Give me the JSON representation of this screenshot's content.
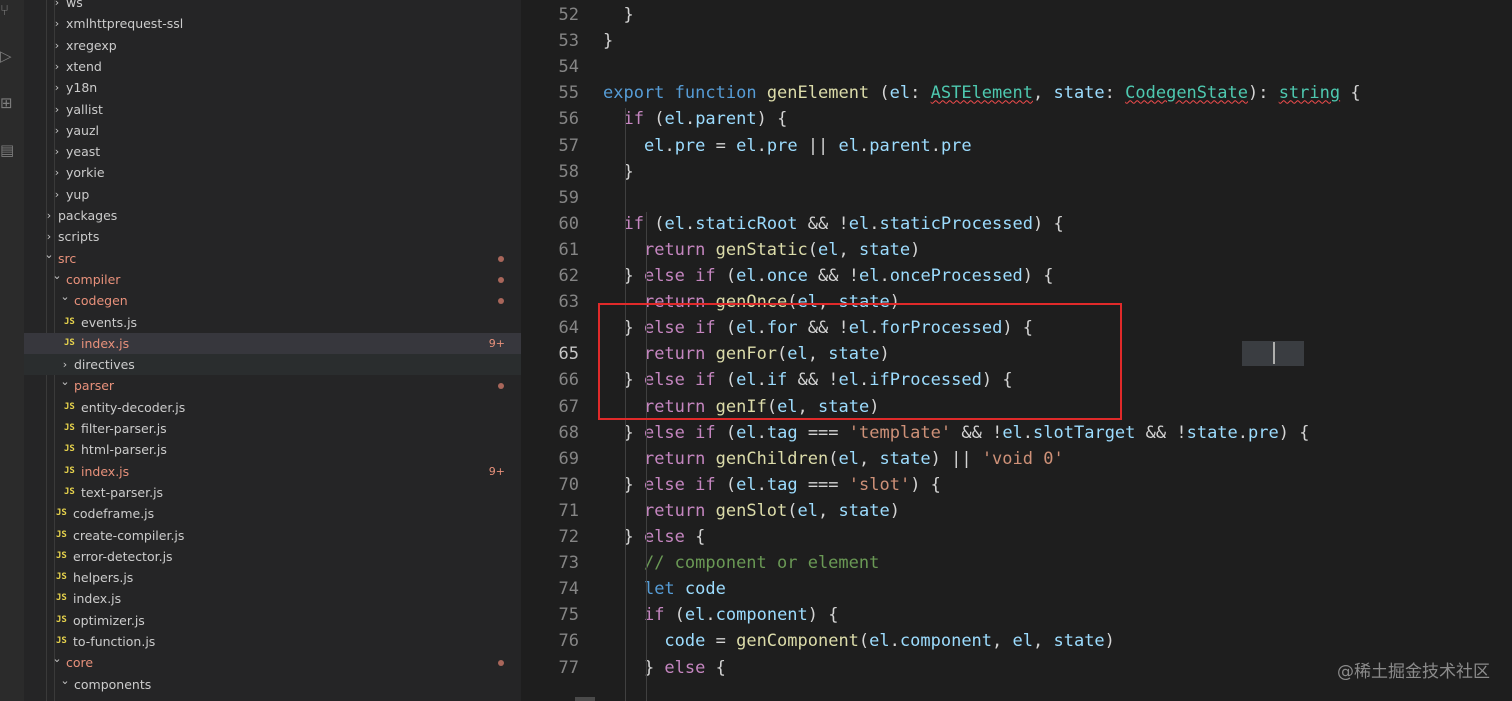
{
  "explorer": {
    "rows": [
      {
        "name": "ws",
        "kind": "folder",
        "depth": 1
      },
      {
        "name": "xmlhttprequest-ssl",
        "kind": "folder",
        "depth": 1
      },
      {
        "name": "xregexp",
        "kind": "folder",
        "depth": 1
      },
      {
        "name": "xtend",
        "kind": "folder",
        "depth": 1
      },
      {
        "name": "y18n",
        "kind": "folder",
        "depth": 1
      },
      {
        "name": "yallist",
        "kind": "folder",
        "depth": 1
      },
      {
        "name": "yauzl",
        "kind": "folder",
        "depth": 1
      },
      {
        "name": "yeast",
        "kind": "folder",
        "depth": 1
      },
      {
        "name": "yorkie",
        "kind": "folder",
        "depth": 1
      },
      {
        "name": "yup",
        "kind": "folder",
        "depth": 1
      },
      {
        "name": "packages",
        "kind": "folder",
        "depth": 0
      },
      {
        "name": "scripts",
        "kind": "folder",
        "depth": 0
      },
      {
        "name": "src",
        "kind": "folder",
        "depth": 0,
        "open": true,
        "modified": true,
        "dot": true
      },
      {
        "name": "compiler",
        "kind": "folder",
        "depth": 1,
        "open": true,
        "modified": true,
        "dot": true
      },
      {
        "name": "codegen",
        "kind": "folder",
        "depth": 2,
        "open": true,
        "modified": true,
        "dot": true
      },
      {
        "name": "events.js",
        "kind": "file",
        "depth": 3
      },
      {
        "name": "index.js",
        "kind": "file",
        "depth": 3,
        "modified": true,
        "selected": true,
        "badge": "9+"
      },
      {
        "name": "directives",
        "kind": "folder",
        "depth": 2,
        "hover": true
      },
      {
        "name": "parser",
        "kind": "folder",
        "depth": 2,
        "open": true,
        "modified": true,
        "dot": true
      },
      {
        "name": "entity-decoder.js",
        "kind": "file",
        "depth": 3
      },
      {
        "name": "filter-parser.js",
        "kind": "file",
        "depth": 3
      },
      {
        "name": "html-parser.js",
        "kind": "file",
        "depth": 3
      },
      {
        "name": "index.js",
        "kind": "file",
        "depth": 3,
        "modified": true,
        "badge": "9+"
      },
      {
        "name": "text-parser.js",
        "kind": "file",
        "depth": 3
      },
      {
        "name": "codeframe.js",
        "kind": "file",
        "depth": 2
      },
      {
        "name": "create-compiler.js",
        "kind": "file",
        "depth": 2
      },
      {
        "name": "error-detector.js",
        "kind": "file",
        "depth": 2
      },
      {
        "name": "helpers.js",
        "kind": "file",
        "depth": 2
      },
      {
        "name": "index.js",
        "kind": "file",
        "depth": 2
      },
      {
        "name": "optimizer.js",
        "kind": "file",
        "depth": 2
      },
      {
        "name": "to-function.js",
        "kind": "file",
        "depth": 2
      },
      {
        "name": "core",
        "kind": "folder",
        "depth": 1,
        "open": true,
        "modified": true,
        "dot": true
      },
      {
        "name": "components",
        "kind": "folder",
        "depth": 2,
        "open": true
      }
    ]
  },
  "editor": {
    "current_line": 65,
    "lines": [
      {
        "n": 52,
        "tokens": [
          [
            "  }",
            ""
          ]
        ]
      },
      {
        "n": 53,
        "tokens": [
          [
            "}",
            ""
          ]
        ]
      },
      {
        "n": 54,
        "tokens": []
      },
      {
        "n": 55,
        "tokens": [
          [
            "export",
            "sto"
          ],
          [
            " ",
            ""
          ],
          [
            "function",
            "sto"
          ],
          [
            " ",
            ""
          ],
          [
            "genElement",
            "fn"
          ],
          [
            " (",
            ""
          ],
          [
            "el",
            "var"
          ],
          [
            ": ",
            ""
          ],
          [
            "ASTElement",
            "type err"
          ],
          [
            ", ",
            ""
          ],
          [
            "state",
            "var"
          ],
          [
            ": ",
            ""
          ],
          [
            "CodegenState",
            "type err"
          ],
          [
            "): ",
            ""
          ],
          [
            "string",
            "type err"
          ],
          [
            " {",
            ""
          ]
        ]
      },
      {
        "n": 56,
        "tokens": [
          [
            "  ",
            ""
          ],
          [
            "if",
            "kw"
          ],
          [
            " (",
            ""
          ],
          [
            "el",
            "var"
          ],
          [
            ".",
            ""
          ],
          [
            "parent",
            "var"
          ],
          [
            ") {",
            ""
          ]
        ]
      },
      {
        "n": 57,
        "tokens": [
          [
            "    ",
            ""
          ],
          [
            "el",
            "var"
          ],
          [
            ".",
            ""
          ],
          [
            "pre",
            "var"
          ],
          [
            " = ",
            ""
          ],
          [
            "el",
            "var"
          ],
          [
            ".",
            ""
          ],
          [
            "pre",
            "var"
          ],
          [
            " || ",
            ""
          ],
          [
            "el",
            "var"
          ],
          [
            ".",
            ""
          ],
          [
            "parent",
            "var"
          ],
          [
            ".",
            ""
          ],
          [
            "pre",
            "var"
          ]
        ]
      },
      {
        "n": 58,
        "tokens": [
          [
            "  }",
            ""
          ]
        ]
      },
      {
        "n": 59,
        "tokens": []
      },
      {
        "n": 60,
        "tokens": [
          [
            "  ",
            ""
          ],
          [
            "if",
            "kw"
          ],
          [
            " (",
            ""
          ],
          [
            "el",
            "var"
          ],
          [
            ".",
            ""
          ],
          [
            "staticRoot",
            "var"
          ],
          [
            " && !",
            ""
          ],
          [
            "el",
            "var"
          ],
          [
            ".",
            ""
          ],
          [
            "staticProcessed",
            "var"
          ],
          [
            ") {",
            ""
          ]
        ]
      },
      {
        "n": 61,
        "tokens": [
          [
            "    ",
            ""
          ],
          [
            "return",
            "kw"
          ],
          [
            " ",
            ""
          ],
          [
            "genStatic",
            "fn"
          ],
          [
            "(",
            ""
          ],
          [
            "el",
            "var"
          ],
          [
            ", ",
            ""
          ],
          [
            "state",
            "var"
          ],
          [
            ")",
            ""
          ]
        ]
      },
      {
        "n": 62,
        "tokens": [
          [
            "  } ",
            ""
          ],
          [
            "else",
            "kw"
          ],
          [
            " ",
            ""
          ],
          [
            "if",
            "kw"
          ],
          [
            " (",
            ""
          ],
          [
            "el",
            "var"
          ],
          [
            ".",
            ""
          ],
          [
            "once",
            "var"
          ],
          [
            " && !",
            ""
          ],
          [
            "el",
            "var"
          ],
          [
            ".",
            ""
          ],
          [
            "onceProcessed",
            "var"
          ],
          [
            ") {",
            ""
          ]
        ]
      },
      {
        "n": 63,
        "tokens": [
          [
            "    ",
            ""
          ],
          [
            "return",
            "kw"
          ],
          [
            " ",
            ""
          ],
          [
            "genOnce",
            "fn"
          ],
          [
            "(",
            ""
          ],
          [
            "el",
            "var"
          ],
          [
            ", ",
            ""
          ],
          [
            "state",
            "var"
          ],
          [
            ")",
            ""
          ]
        ]
      },
      {
        "n": 64,
        "tokens": [
          [
            "  } ",
            ""
          ],
          [
            "else",
            "kw"
          ],
          [
            " ",
            ""
          ],
          [
            "if",
            "kw"
          ],
          [
            " (",
            ""
          ],
          [
            "el",
            "var"
          ],
          [
            ".",
            ""
          ],
          [
            "for",
            "var"
          ],
          [
            " && !",
            ""
          ],
          [
            "el",
            "var"
          ],
          [
            ".",
            ""
          ],
          [
            "forProcessed",
            "var"
          ],
          [
            ") {",
            ""
          ]
        ]
      },
      {
        "n": 65,
        "tokens": [
          [
            "    ",
            ""
          ],
          [
            "return",
            "kw"
          ],
          [
            " ",
            ""
          ],
          [
            "genFor",
            "fn"
          ],
          [
            "(",
            ""
          ],
          [
            "el",
            "var"
          ],
          [
            ", ",
            ""
          ],
          [
            "state",
            "var"
          ],
          [
            ")",
            ""
          ]
        ]
      },
      {
        "n": 66,
        "tokens": [
          [
            "  } ",
            ""
          ],
          [
            "else",
            "kw"
          ],
          [
            " ",
            ""
          ],
          [
            "if",
            "kw"
          ],
          [
            " (",
            ""
          ],
          [
            "el",
            "var"
          ],
          [
            ".",
            ""
          ],
          [
            "if",
            "var"
          ],
          [
            " && !",
            ""
          ],
          [
            "el",
            "var"
          ],
          [
            ".",
            ""
          ],
          [
            "ifProcessed",
            "var"
          ],
          [
            ") {",
            ""
          ]
        ]
      },
      {
        "n": 67,
        "tokens": [
          [
            "    ",
            ""
          ],
          [
            "return",
            "kw"
          ],
          [
            " ",
            ""
          ],
          [
            "genIf",
            "fn"
          ],
          [
            "(",
            ""
          ],
          [
            "el",
            "var"
          ],
          [
            ", ",
            ""
          ],
          [
            "state",
            "var"
          ],
          [
            ")",
            ""
          ]
        ]
      },
      {
        "n": 68,
        "tokens": [
          [
            "  } ",
            ""
          ],
          [
            "else",
            "kw"
          ],
          [
            " ",
            ""
          ],
          [
            "if",
            "kw"
          ],
          [
            " (",
            ""
          ],
          [
            "el",
            "var"
          ],
          [
            ".",
            ""
          ],
          [
            "tag",
            "var"
          ],
          [
            " === ",
            ""
          ],
          [
            "'template'",
            "str"
          ],
          [
            " && !",
            ""
          ],
          [
            "el",
            "var"
          ],
          [
            ".",
            ""
          ],
          [
            "slotTarget",
            "var"
          ],
          [
            " && !",
            ""
          ],
          [
            "state",
            "var"
          ],
          [
            ".",
            ""
          ],
          [
            "pre",
            "var"
          ],
          [
            ") {",
            ""
          ]
        ]
      },
      {
        "n": 69,
        "tokens": [
          [
            "    ",
            ""
          ],
          [
            "return",
            "kw"
          ],
          [
            " ",
            ""
          ],
          [
            "genChildren",
            "fn"
          ],
          [
            "(",
            ""
          ],
          [
            "el",
            "var"
          ],
          [
            ", ",
            ""
          ],
          [
            "state",
            "var"
          ],
          [
            ") || ",
            ""
          ],
          [
            "'void 0'",
            "str"
          ]
        ]
      },
      {
        "n": 70,
        "tokens": [
          [
            "  } ",
            ""
          ],
          [
            "else",
            "kw"
          ],
          [
            " ",
            ""
          ],
          [
            "if",
            "kw"
          ],
          [
            " (",
            ""
          ],
          [
            "el",
            "var"
          ],
          [
            ".",
            ""
          ],
          [
            "tag",
            "var"
          ],
          [
            " === ",
            ""
          ],
          [
            "'slot'",
            "str"
          ],
          [
            ") {",
            ""
          ]
        ]
      },
      {
        "n": 71,
        "tokens": [
          [
            "    ",
            ""
          ],
          [
            "return",
            "kw"
          ],
          [
            " ",
            ""
          ],
          [
            "genSlot",
            "fn"
          ],
          [
            "(",
            ""
          ],
          [
            "el",
            "var"
          ],
          [
            ", ",
            ""
          ],
          [
            "state",
            "var"
          ],
          [
            ")",
            ""
          ]
        ]
      },
      {
        "n": 72,
        "tokens": [
          [
            "  } ",
            ""
          ],
          [
            "else",
            "kw"
          ],
          [
            " {",
            ""
          ]
        ]
      },
      {
        "n": 73,
        "tokens": [
          [
            "    ",
            ""
          ],
          [
            "// component or element",
            "cmt"
          ]
        ]
      },
      {
        "n": 74,
        "tokens": [
          [
            "    ",
            ""
          ],
          [
            "let",
            "sto"
          ],
          [
            " ",
            ""
          ],
          [
            "code",
            "var"
          ]
        ]
      },
      {
        "n": 75,
        "tokens": [
          [
            "    ",
            ""
          ],
          [
            "if",
            "kw"
          ],
          [
            " (",
            ""
          ],
          [
            "el",
            "var"
          ],
          [
            ".",
            ""
          ],
          [
            "component",
            "var"
          ],
          [
            ") {",
            ""
          ]
        ]
      },
      {
        "n": 76,
        "tokens": [
          [
            "      ",
            ""
          ],
          [
            "code",
            "var"
          ],
          [
            " = ",
            ""
          ],
          [
            "genComponent",
            "fn"
          ],
          [
            "(",
            ""
          ],
          [
            "el",
            "var"
          ],
          [
            ".",
            ""
          ],
          [
            "component",
            "var"
          ],
          [
            ", ",
            ""
          ],
          [
            "el",
            "var"
          ],
          [
            ", ",
            ""
          ],
          [
            "state",
            "var"
          ],
          [
            ")",
            ""
          ]
        ]
      },
      {
        "n": 77,
        "tokens": [
          [
            "    } ",
            ""
          ],
          [
            "else",
            "kw"
          ],
          [
            " {",
            ""
          ]
        ]
      }
    ]
  },
  "watermark": "@稀土掘金技术社区",
  "colors": {
    "modified": "#e8917b",
    "highlight_box": "#e02a2a",
    "js_icon": "#e8d44d"
  }
}
